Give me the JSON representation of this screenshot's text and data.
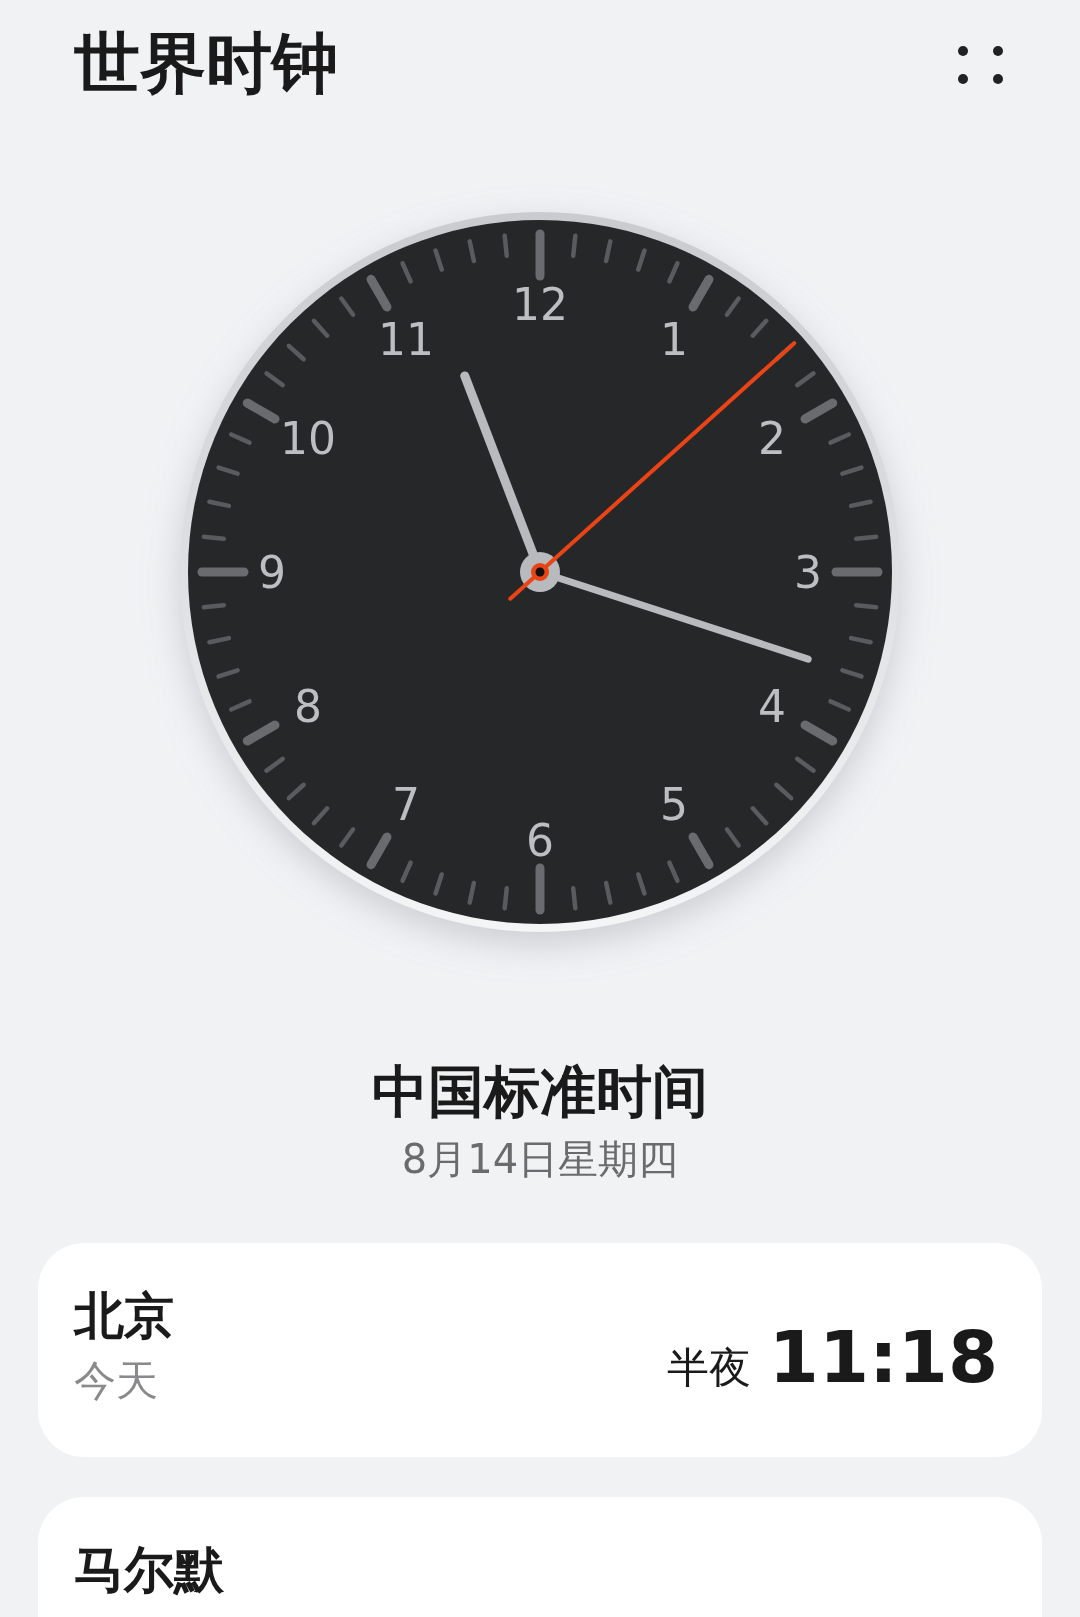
{
  "title": "世界时钟",
  "clock": {
    "numerals": [
      "12",
      "1",
      "2",
      "3",
      "4",
      "5",
      "6",
      "7",
      "8",
      "9",
      "10",
      "11"
    ]
  },
  "zone": {
    "name": "中国标准时间",
    "date": "8月14日星期四"
  },
  "cities": [
    {
      "name": "北京",
      "day": "今天",
      "period": "半夜",
      "time": "11:18"
    },
    {
      "name": "马尔默"
    }
  ]
}
